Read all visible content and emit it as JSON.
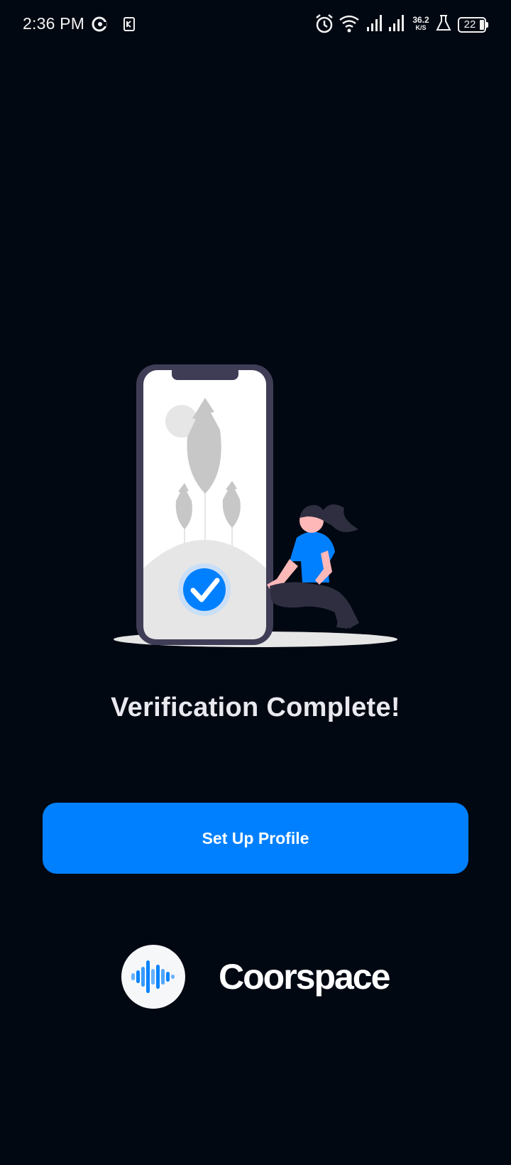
{
  "status_bar": {
    "time": "2:36 PM",
    "net_speed_value": "36.2",
    "net_speed_unit": "K/S",
    "battery": "22",
    "icons": [
      "app-c-icon",
      "sim-card-icon",
      "alarm-icon",
      "wifi-icon",
      "signal-icon",
      "signal-icon",
      "lab-flask-icon",
      "battery-icon"
    ]
  },
  "illustration": {
    "subject": "phone-with-checkmark-and-woman",
    "accent_color": "#0080ff"
  },
  "main": {
    "headline": "Verification Complete!",
    "primary_button_label": "Set Up Profile"
  },
  "brand": {
    "name": "Coorspace",
    "logo_icon": "audio-wave-icon"
  },
  "colors": {
    "background": "#020812",
    "accent": "#0080ff",
    "text": "#e9e9ef"
  }
}
